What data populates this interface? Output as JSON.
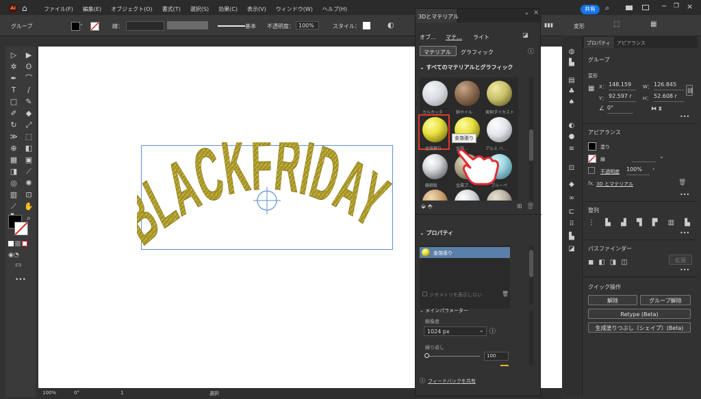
{
  "menubar": {
    "items": [
      "ファイル(F)",
      "編集(E)",
      "オブジェクト(O)",
      "書式(T)",
      "選択(S)",
      "効果(C)",
      "表示(V)",
      "ウィンドウ(W)",
      "ヘルプ(H)"
    ],
    "share_label": "共有"
  },
  "control_bar": {
    "group_label": "グループ",
    "stroke_label": "線：",
    "stroke_style": "基本",
    "opacity_label": "不透明度：",
    "opacity_value": "100%",
    "style_label": "スタイル：",
    "transform_label": "変形"
  },
  "canvas": {
    "artwork_text": "BLACKFRIDAY",
    "artwork_color": "#b5a330"
  },
  "statusbar": {
    "zoom": "100%",
    "rotation": "0°",
    "artboard": "1",
    "mode": "選択"
  },
  "panel_3d": {
    "title": "3Dとマテリアル",
    "top_tabs": [
      "オブ…",
      "マテ…",
      "ライト"
    ],
    "sub_tabs": [
      "マテリアル",
      "グラフィック"
    ],
    "section_all": "すべてのマテリアルとグラフィック",
    "materials": [
      {
        "name": "カルカッタ",
        "color": "#d9dde0",
        "shade": "#8e9296"
      },
      {
        "name": "銅ホイル",
        "color": "#8a6a4e",
        "shade": "#3c2a1c"
      },
      {
        "name": "黄銅ダイカスト",
        "color": "#c8c06a",
        "shade": "#4b4518"
      },
      {
        "name": "金箔張り",
        "color": "#e8e040",
        "shade": "#5a5200"
      },
      {
        "name": "金箔...",
        "color": "#e8e040",
        "shade": "#5a5200"
      },
      {
        "name": "アルミ ハ…",
        "color": "#e0e4e8",
        "shade": "#707478"
      },
      {
        "name": "鏡鋼板",
        "color": "#d8dcde",
        "shade": "#3a3e42"
      },
      {
        "name": "金属プ…",
        "color": "#a89c80",
        "shade": "#504636"
      },
      {
        "name": "ブルーペ",
        "color": "#9ed6e0",
        "shade": "#2e6c78"
      },
      {
        "name": "",
        "color": "#c9a070",
        "shade": "#5a3a20"
      },
      {
        "name": "",
        "color": "#d0d2d4",
        "shade": "#5c6064"
      },
      {
        "name": "",
        "color": "#b8b0a0",
        "shade": "#3a342c"
      }
    ],
    "tooltip": "金箔張り",
    "properties_title": "プロパティ",
    "selected_material": "金箔張り",
    "hide_geometry_label": "ジオメトリを表示しない",
    "main_params_title": "メインパラメーター",
    "resolution_label": "解像度",
    "resolution_value": "1024 px",
    "repeat_label": "繰り返し",
    "repeat_value": "100",
    "feedback_label": "フィードバックを共有"
  },
  "props_panel": {
    "tabs": [
      "プロパティ",
      "アピアランス"
    ],
    "group_label": "グループ",
    "transform_title": "変形",
    "x_label": "X：",
    "x_value": "148.159",
    "y_label": "Y：",
    "y_value": "92.597 r",
    "w_label": "W：",
    "w_value": "126.845",
    "h_label": "H：",
    "h_value": "52.608 r",
    "rotate_value": "0°",
    "appearance_title": "アピアランス",
    "fill_label": "塗り",
    "stroke_label": "線",
    "opacity_label": "不透明度",
    "opacity_value": "100%",
    "fx_label": "3D とマテリアル",
    "align_title": "整列",
    "pathfinder_title": "パスファインダー",
    "expand_button": "拡張",
    "quick_actions_title": "クイック操作",
    "ungroup_short": "解除",
    "ungroup_button": "グループ解除",
    "retype_button": "Retype (Beta)",
    "genfill_button": "生成塗りつぶし（シェイプ）(Beta)"
  }
}
